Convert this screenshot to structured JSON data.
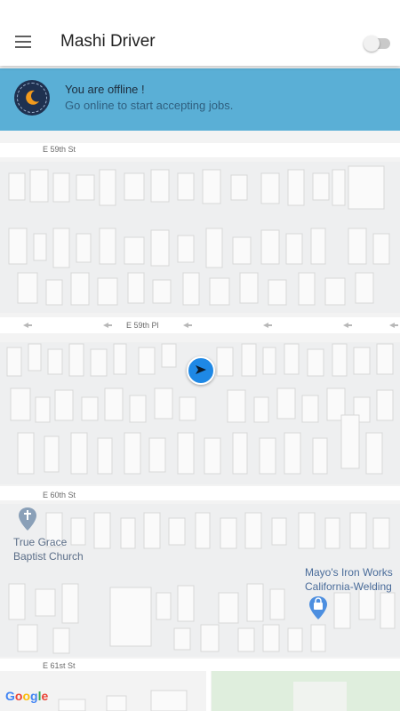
{
  "appbar": {
    "title": "Mashi Driver",
    "menu_icon": "menu-icon",
    "toggle_state": "off"
  },
  "banner": {
    "title": "You are offline !",
    "subtitle": "Go online to start accepting jobs.",
    "icon": "moon-icon"
  },
  "map": {
    "streets": [
      "E 59th St",
      "E 59th Pl",
      "E 60th St",
      "E 61st St"
    ],
    "pois": [
      {
        "name_line1": "True Grace",
        "name_line2": "Baptist Church",
        "icon": "church-pin-icon"
      },
      {
        "name_line1": "Mayo's Iron Works",
        "name_line2": "California-Welding",
        "icon": "shopping-pin-icon"
      }
    ],
    "attribution": "Google"
  },
  "colors": {
    "banner_bg": "#5aafd6",
    "appbar_bg": "#ffffff",
    "location_dot": "#1e88e5",
    "map_bg": "#f3f3f3"
  }
}
